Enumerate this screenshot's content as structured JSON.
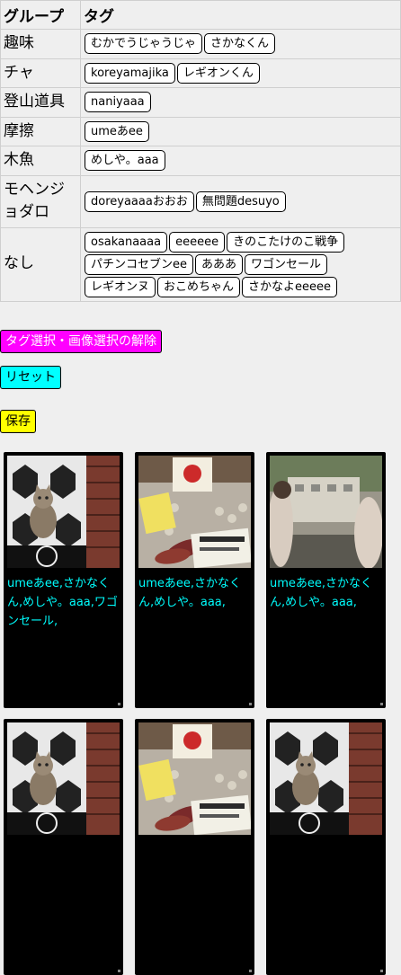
{
  "table": {
    "header_group": "グループ",
    "header_tag": "タグ",
    "rows": [
      {
        "group": "趣味",
        "tags": [
          "むかでうじゃうじゃ",
          "さかなくん"
        ]
      },
      {
        "group": "チャ",
        "tags": [
          "koreyamajika",
          "レギオンくん"
        ]
      },
      {
        "group": "登山道具",
        "tags": [
          "naniyaaa"
        ]
      },
      {
        "group": "摩擦",
        "tags": [
          "umeあee"
        ]
      },
      {
        "group": "木魚",
        "tags": [
          "めしや。aaa"
        ]
      },
      {
        "group": "モヘンジョダロ",
        "tags": [
          "doreyaaaaおおお",
          "無問題desuyo"
        ]
      },
      {
        "group": "なし",
        "tags": [
          "osakanaaaa",
          "eeeeee",
          "きのこたけのこ戦争",
          "パチンコセブンee",
          "あああ",
          "ワゴンセール",
          "レギオンヌ",
          "おこめちゃん",
          "さかなよeeeee"
        ]
      }
    ]
  },
  "buttons": {
    "clear_selection": "タグ選択・画像選択の解除",
    "reset": "リセット",
    "save": "保存"
  },
  "colors": {
    "clear_button": "#ff00ff",
    "reset_button": "#00ffff",
    "save_button": "#ffff00",
    "caption_text": "#00ffff",
    "card_background": "#000000"
  },
  "images": [
    {
      "photo": "cat-photo",
      "caption": "umeあee,さかなくん,めしや。aaa,ワゴンセール,"
    },
    {
      "photo": "food-stall-photo",
      "caption": "umeあee,さかなくん,めしや。aaa,"
    },
    {
      "photo": "street-photo",
      "caption": "umeあee,さかなくん,めしや。aaa,"
    },
    {
      "photo": "cat-photo",
      "caption": ""
    },
    {
      "photo": "food-stall-photo",
      "caption": ""
    },
    {
      "photo": "cat-photo",
      "caption": ""
    }
  ]
}
